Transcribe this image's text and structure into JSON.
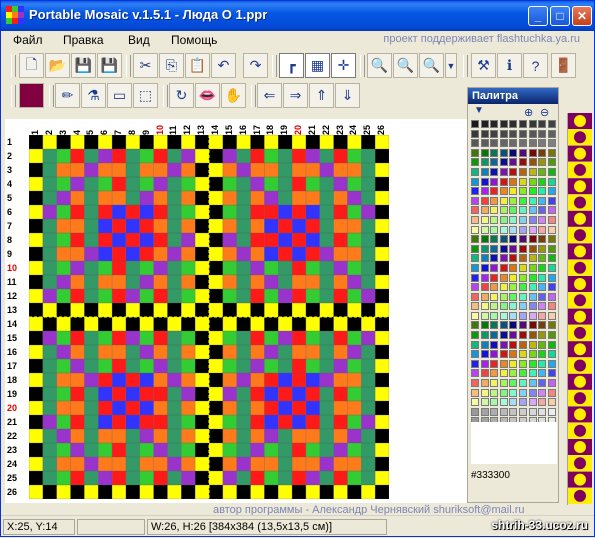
{
  "window": {
    "title": "Portable Mosaic v.1.5.1 - Люда О 1.ppr",
    "buttons": {
      "minimize": "_",
      "maximize": "□",
      "close": "✕"
    }
  },
  "menu": {
    "items": [
      "Файл",
      "Правка",
      "Вид",
      "Помощь"
    ],
    "promo": "проект поддерживает flashtuchka.ya.ru"
  },
  "toolbar1": [
    "new-file",
    "open-folder",
    "save",
    "save-as",
    "cut",
    "copy",
    "paste",
    "undo",
    "redo",
    "grid-corner",
    "grid-full",
    "crosshair",
    "zoom-out",
    "zoom-in",
    "zoom",
    "zoom-menu",
    "tools",
    "info",
    "help",
    "exit"
  ],
  "toolbar2": {
    "current_color": "#800040",
    "tools": [
      "pencil",
      "eyedropper",
      "eraser",
      "select",
      "rotate",
      "flip-lips",
      "fill-hand",
      "arrow-left",
      "arrow-right",
      "arrow-up",
      "arrow-down"
    ]
  },
  "grid": {
    "columns": [
      "1",
      "2",
      "3",
      "4",
      "5",
      "6",
      "7",
      "8",
      "9",
      "10",
      "11",
      "12",
      "13",
      "14",
      "15",
      "16",
      "17",
      "18",
      "19",
      "20",
      "21",
      "22",
      "23",
      "24",
      "25",
      "26"
    ],
    "rows": [
      "1",
      "2",
      "3",
      "4",
      "5",
      "6",
      "7",
      "8",
      "9",
      "10",
      "11",
      "12",
      "13",
      "14",
      "15",
      "16",
      "17",
      "18",
      "19",
      "20",
      "21",
      "22",
      "23",
      "24",
      "25",
      "26"
    ],
    "highlight_numbers": [
      "10",
      "20"
    ],
    "colors": {
      "red": "#ff1a1a",
      "orange": "#ff7a1a",
      "green": "#33cc33",
      "teal": "#339966",
      "yellow": "#ffff00",
      "black": "#000000",
      "blue": "#3333ff",
      "purple": "#9933cc"
    }
  },
  "signature": "автор программы - Александр Чернявский shuriksoft@mail.ru",
  "palette": {
    "title": "Палитра",
    "selected_hex": "#333300"
  },
  "status": {
    "cursor": "X:25, Y:14",
    "size": "W:26, H:26 [384x384 (13,5x13,5 см)]",
    "watermark": "shtrih-33.ucoz.ru"
  }
}
